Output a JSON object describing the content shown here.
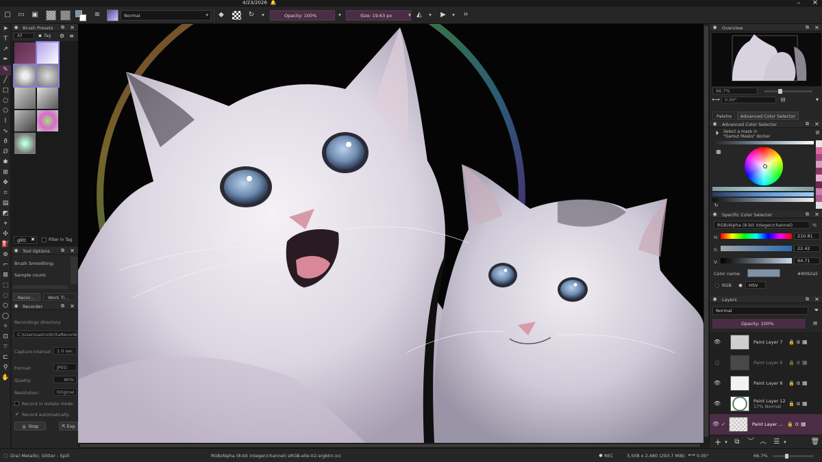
{
  "titlebar": {
    "date": "4/23/2026"
  },
  "toolbar": {
    "blend_mode": "Normal",
    "opacity": "Opacity: 100%",
    "size": "Size: 19.63 px"
  },
  "brush_presets": {
    "title": "Brush Presets",
    "filter_all": "All",
    "tag_label": "Tag",
    "search_value": "glitt",
    "filter_in_tag": "Filter in Tag"
  },
  "tool_options": {
    "title": "Tool Options",
    "brush_smoothing": "Brush Smoothing:",
    "sample_count": "Sample count:",
    "tab_recorder": "Recor...",
    "tab_worktime": "Work Ti..."
  },
  "recorder": {
    "title": "Recorder",
    "recordings_directory_label": "Recordings directory:",
    "recordings_directory_value": "C:\\Users\\astro\\KritaRecorder",
    "capture_interval_label": "Capture interval:",
    "capture_interval_value": "1.0 sec.",
    "format_label": "Format:",
    "format_value": "JPEG",
    "quality_label": "Quality:",
    "quality_value": "80%",
    "resolution_label": "Resolution:",
    "resolution_value": "Original",
    "record_isolate": "Record in isolate mode",
    "record_auto": "Record automatically",
    "stop_button": "Stop",
    "export_button": "Exp"
  },
  "overview": {
    "title": "Overview",
    "zoom": "66.7%",
    "rotation": "0.00°"
  },
  "color_tabs": {
    "palette": "Palette",
    "advanced": "Advanced Color Selector"
  },
  "advanced_color": {
    "title": "Advanced Color Selector",
    "mask_hint_1": "Select a mask in",
    "mask_hint_2": "\"Gamut Masks\" docker"
  },
  "specific_color": {
    "title": "Specific Color Selector",
    "colorspace": "RGB/Alpha (8-bit integer/channel)",
    "percent": "%",
    "h_label": "H:",
    "h_value": "210.81",
    "s_label": "S:",
    "s_value": "22.42",
    "v_label": "V:",
    "v_value": "64.71",
    "color_name_label": "Color name:",
    "hex_value": "#8092a5",
    "rgb_label": "RGB",
    "hsv_label": "HSV",
    "swatch_color": "#8092a5"
  },
  "layers": {
    "title": "Layers",
    "blend": "Normal",
    "opacity": "Opacity:  100%",
    "items": [
      {
        "name": "Paint Layer 7",
        "sub": ""
      },
      {
        "name": "Paint Layer 6",
        "sub": ""
      },
      {
        "name": "Paint Layer 8",
        "sub": ""
      },
      {
        "name": "Paint Layer 12",
        "sub": "17% Normal"
      },
      {
        "name": "Paint Layer ...",
        "sub": ""
      }
    ]
  },
  "status": {
    "brush": "Dra) Metallic; Glitter - Spill",
    "colorspace": "RGB/Alpha (8-bit integer/channel)  sRGB-elle-V2-srgbtrc.icc",
    "rec": "REC",
    "dimensions": "3,508 x 2,480 (293.7 MiB)",
    "rotation": "0.00°",
    "zoom": "66.7%"
  },
  "colors": {
    "accent": "#6a3a5c",
    "layer_selected": "#4d2c45"
  }
}
